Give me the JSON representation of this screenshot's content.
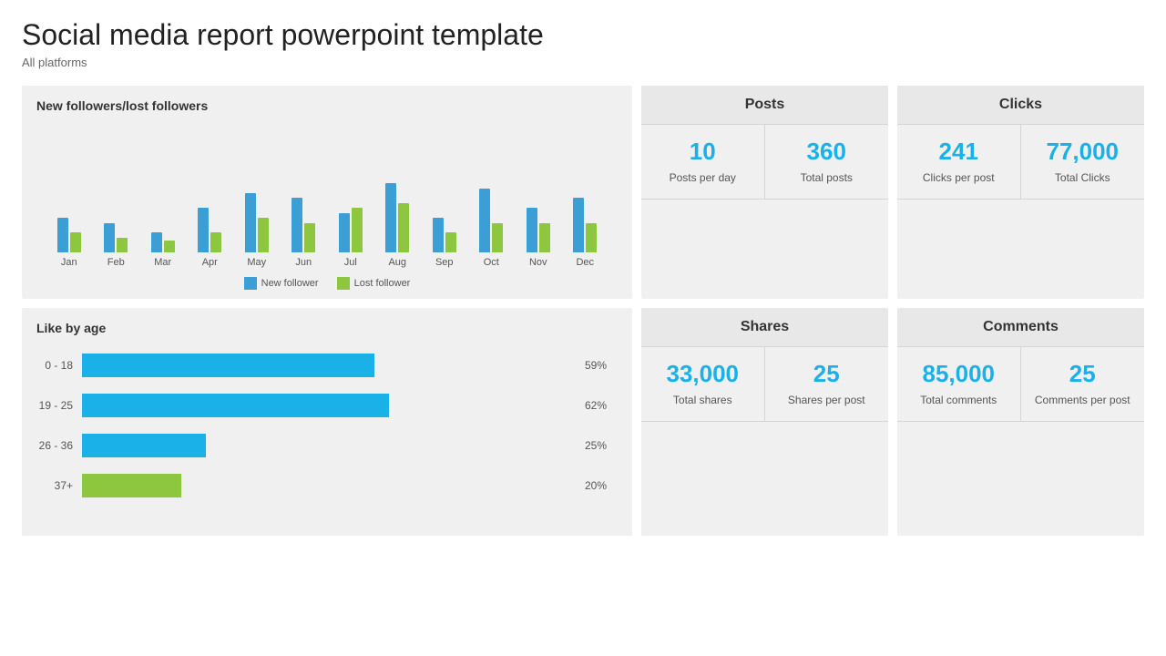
{
  "page": {
    "title": "Social media report powerpoint template",
    "subtitle": "All platforms"
  },
  "bar_chart": {
    "title": "New followers/lost followers",
    "months": [
      "Jan",
      "Feb",
      "Mar",
      "Apr",
      "May",
      "Jun",
      "Jul",
      "Aug",
      "Sep",
      "Oct",
      "Nov",
      "Dec"
    ],
    "blue_bars": [
      35,
      30,
      20,
      45,
      60,
      55,
      40,
      70,
      35,
      65,
      45,
      55
    ],
    "green_bars": [
      20,
      15,
      12,
      20,
      35,
      30,
      45,
      50,
      20,
      30,
      30,
      30
    ],
    "legend_blue": "New follower",
    "legend_green": "Lost follower"
  },
  "age_chart": {
    "title": "Like by age",
    "rows": [
      {
        "label": "0 - 18",
        "pct": 59,
        "color": "blue"
      },
      {
        "label": "19 - 25",
        "pct": 62,
        "color": "blue"
      },
      {
        "label": "26 - 36",
        "pct": 25,
        "color": "blue"
      },
      {
        "label": "37+",
        "pct": 20,
        "color": "green"
      }
    ]
  },
  "posts": {
    "header": "Posts",
    "value1": "10",
    "label1": "Posts per day",
    "value2": "360",
    "label2": "Total posts"
  },
  "clicks": {
    "header": "Clicks",
    "value1": "241",
    "label1": "Clicks per post",
    "value2": "77,000",
    "label2": "Total Clicks"
  },
  "shares": {
    "header": "Shares",
    "value1": "33,000",
    "label1": "Total shares",
    "value2": "25",
    "label2": "Shares per post"
  },
  "comments": {
    "header": "Comments",
    "value1": "85,000",
    "label1": "Total comments",
    "value2": "25",
    "label2": "Comments per post"
  }
}
